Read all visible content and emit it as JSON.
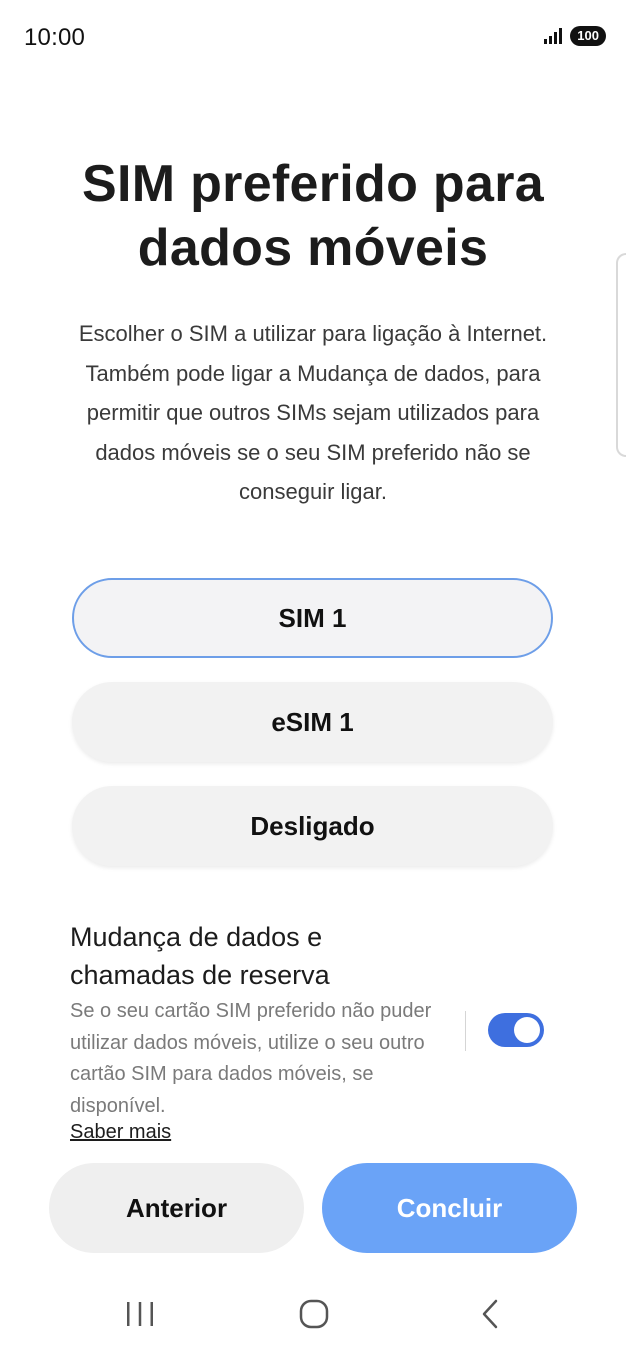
{
  "status_bar": {
    "time": "10:00",
    "battery": "100",
    "icons": [
      "signal-icon",
      "battery-icon"
    ]
  },
  "page": {
    "title": "SIM preferido para dados móveis",
    "description": "Escolher o SIM a utilizar para ligação à Internet. Também pode ligar a Mudança de dados, para permitir que outros SIMs sejam utilizados para dados móveis se o seu SIM preferido não se conseguir ligar."
  },
  "options": [
    {
      "label": "SIM 1",
      "selected": true
    },
    {
      "label": "eSIM 1",
      "selected": false
    },
    {
      "label": "Desligado",
      "selected": false
    }
  ],
  "fallback": {
    "title": "Mudança de dados e chamadas de reserva",
    "description": "Se o seu cartão SIM preferido não puder utilizar dados móveis, utilize o seu outro cartão SIM para dados móveis, se disponível.",
    "learn_more": "Saber mais",
    "toggle_on": true
  },
  "buttons": {
    "previous": "Anterior",
    "finish": "Concluir"
  },
  "nav_bar": {
    "icons": [
      "recent-apps-icon",
      "home-icon",
      "back-icon"
    ]
  },
  "colors": {
    "accent": "#3e6fdf",
    "finish_button": "#6aa3f7",
    "selected_border": "#6d9ee8"
  }
}
